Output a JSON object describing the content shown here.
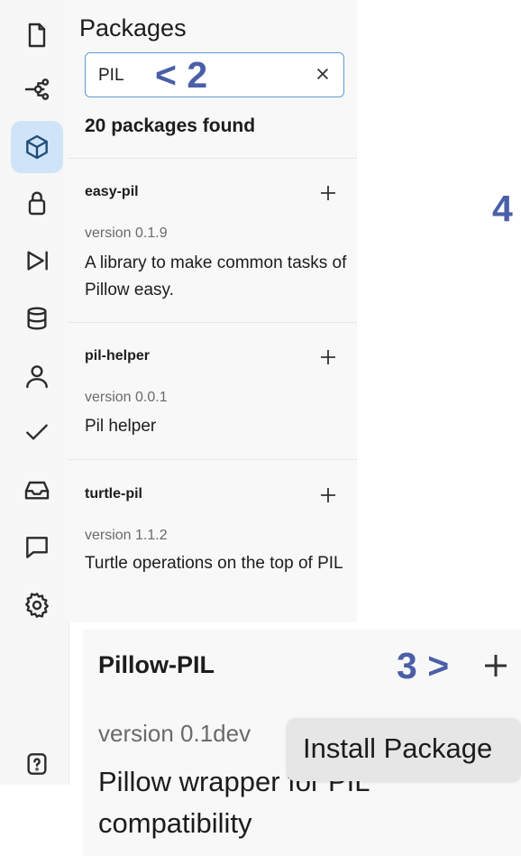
{
  "sidebar": {
    "icons": [
      {
        "name": "file-icon"
      },
      {
        "name": "git-branch-icon"
      },
      {
        "name": "packages-icon",
        "active": true
      },
      {
        "name": "lock-icon"
      },
      {
        "name": "run-icon"
      },
      {
        "name": "database-icon"
      },
      {
        "name": "user-icon"
      },
      {
        "name": "check-icon"
      },
      {
        "name": "inbox-icon"
      },
      {
        "name": "chat-icon"
      },
      {
        "name": "settings-icon"
      },
      {
        "name": "help-icon"
      }
    ],
    "accent_color": "#cfe4f8"
  },
  "panel": {
    "title": "Packages",
    "search": {
      "value": "PIL",
      "placeholder": ""
    },
    "found_text": "20 packages found",
    "packages": [
      {
        "name": "easy-pil",
        "version": "version 0.1.9",
        "description": "A library to make common tasks of Pillow easy."
      },
      {
        "name": "pil-helper",
        "version": "version 0.0.1",
        "description": "Pil helper"
      },
      {
        "name": "turtle-pil",
        "version": "version 1.1.2",
        "description": "Turtle operations on the top of PIL"
      }
    ]
  },
  "zoomed": {
    "name": "Pillow-PIL",
    "version": "version 0.1dev",
    "description": "Pillow wrapper for PIL compatibility",
    "tooltip": "Install Package"
  },
  "annotations": {
    "a2": "< 2",
    "a3": "3 >",
    "a4": "4",
    "color": "#4a5fa7"
  }
}
